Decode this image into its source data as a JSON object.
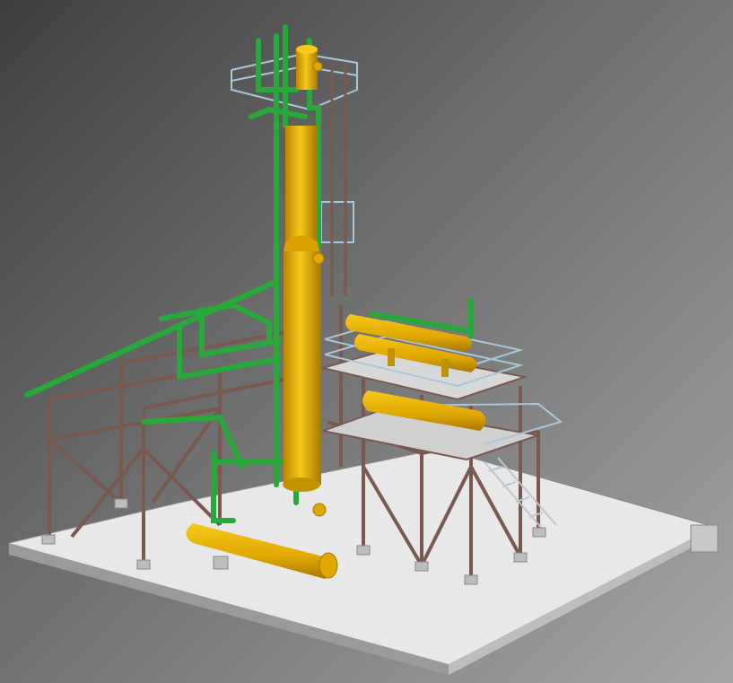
{
  "scene": {
    "subject": "3d-plant-model",
    "colors": {
      "background_dark": "#3f3f3f",
      "background_light": "#a5a5a5",
      "skid": "#e6e6e6",
      "skid_rail": "#9a9a9a",
      "steel": "#7a5a50",
      "vessel": "#e8b00a",
      "vessel_shade": "#b98600",
      "piping": "#27a83a",
      "railing": "#a8c8d8"
    }
  }
}
